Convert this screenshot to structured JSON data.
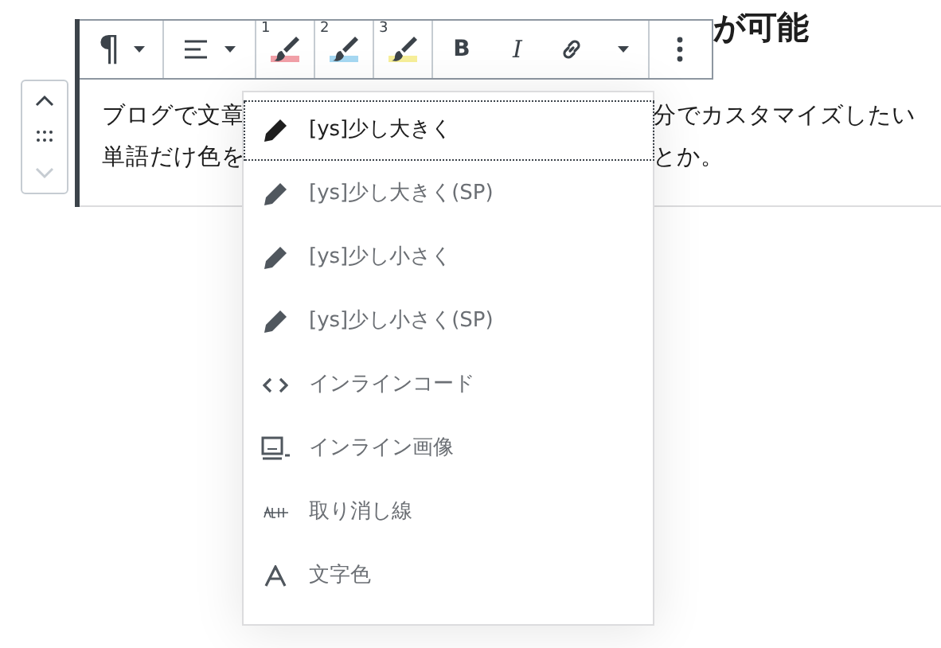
{
  "heading": {
    "visible_text": "が可能"
  },
  "toolbar": {
    "groups": [
      {
        "kind": "dropdown",
        "label": "¶"
      },
      {
        "kind": "align"
      },
      {
        "kind": "markers",
        "items": [
          {
            "number": "1",
            "color": "#f2a0a8"
          },
          {
            "number": "2",
            "color": "#a6d8f2"
          },
          {
            "number": "3",
            "color": "#f7ef9a"
          }
        ]
      },
      {
        "kind": "format",
        "bold": "B",
        "italic": "I"
      },
      {
        "kind": "more"
      }
    ]
  },
  "paragraph": {
    "lines": [
      {
        "left": "ブログで文章",
        "right": "分でカスタマイズしたい"
      },
      {
        "left": "単語だけ色を",
        "right": "とか。"
      }
    ]
  },
  "mover": {
    "up_disabled": false,
    "down_disabled": true
  },
  "menu": {
    "items": [
      {
        "kind": "pencil",
        "label": "[ys]少し大きく",
        "selected": true
      },
      {
        "kind": "pencil",
        "label": "[ys]少し大きく(SP)",
        "selected": false
      },
      {
        "kind": "pencil",
        "label": "[ys]少し小さく",
        "selected": false
      },
      {
        "kind": "pencil",
        "label": "[ys]少し小さく(SP)",
        "selected": false
      },
      {
        "kind": "code",
        "label": "インラインコード",
        "selected": false
      },
      {
        "kind": "image",
        "label": "インライン画像",
        "selected": false
      },
      {
        "kind": "strike",
        "label": "取り消し線",
        "selected": false
      },
      {
        "kind": "color",
        "label": "文字色",
        "selected": false
      }
    ]
  }
}
